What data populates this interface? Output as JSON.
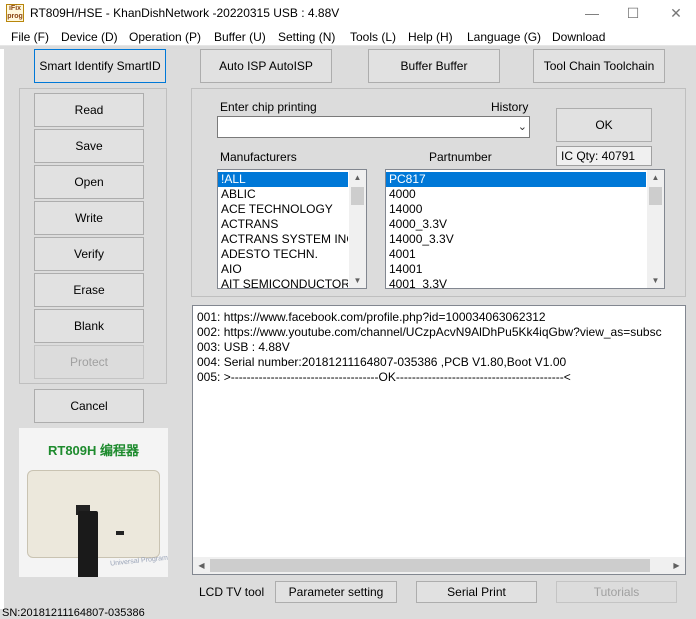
{
  "window": {
    "icon_text": "iFix prog",
    "title": "RT809H/HSE - KhanDishNetwork -20220315  USB : 4.88V"
  },
  "menu": [
    "File (F)",
    "Device (D)",
    "Operation (P)",
    "Buffer (U)",
    "Setting (N)",
    "Tools (L)",
    "Help (H)",
    "Language (G)",
    "Download"
  ],
  "toolbar": {
    "smart_identify": "Smart Identify SmartID",
    "auto_isp": "Auto ISP AutoISP",
    "buffer": "Buffer Buffer",
    "tool_chain": "Tool Chain Toolchain"
  },
  "sidebar": {
    "read": "Read",
    "save": "Save",
    "open": "Open",
    "write": "Write",
    "verify": "Verify",
    "erase": "Erase",
    "blank": "Blank",
    "protect": "Protect",
    "cancel": "Cancel"
  },
  "chip": {
    "enter_label": "Enter chip printing",
    "history_label": "History",
    "input_value": "",
    "ok_label": "OK",
    "ic_qty": "IC Qty: 40791",
    "manufacturers_label": "Manufacturers",
    "partnumber_label": "Partnumber",
    "manufacturers": [
      "!ALL",
      "ABLIC",
      "ACE TECHNOLOGY",
      "ACTRANS",
      "ACTRANS SYSTEM INC",
      "ADESTO TECHN.",
      "AIO",
      "AIT SEMICONDUCTOR"
    ],
    "partnumbers": [
      "PC817",
      "4000",
      "14000",
      "4000_3.3V",
      "14000_3.3V",
      "4001",
      "14001",
      "4001_3.3V"
    ]
  },
  "log": [
    "001:  https://www.facebook.com/profile.php?id=100034063062312",
    "002:  https://www.youtube.com/channel/UCzpAcvN9AlDhPu5Kk4iqGbw?view_as=subsc",
    "003:  USB : 4.88V",
    "004:  Serial number:20181211164807-035386  ,PCB V1.80,Boot V1.00",
    "005:  >-------------------------------------OK------------------------------------------<"
  ],
  "device_image": {
    "caption": "RT809H 编程器",
    "printed_label": "Universal Programmer"
  },
  "bottom": {
    "lcd_tool": "LCD TV tool",
    "parameter_setting": "Parameter setting",
    "serial_print": "Serial Print",
    "tutorials": "Tutorials"
  },
  "status_bar": "SN:20181211164807-035386",
  "colors": {
    "selection": "#0078d7",
    "caption_green": "#1e8b2e"
  }
}
